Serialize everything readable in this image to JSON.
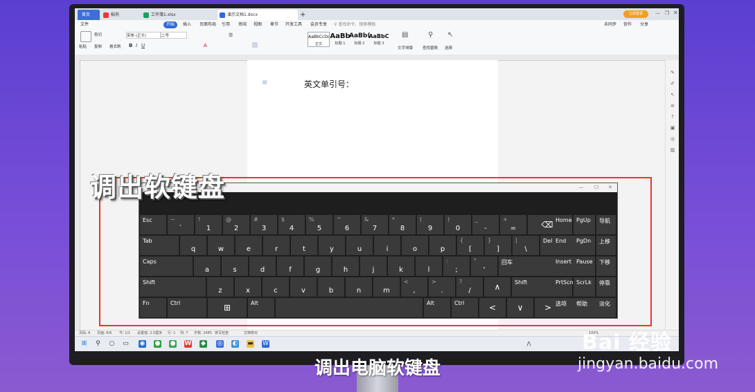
{
  "tabs": [
    {
      "label": "首页"
    },
    {
      "label": "稻壳"
    },
    {
      "label": "工作簿1.xlsx"
    },
    {
      "label": "演示文档1.docx"
    }
  ],
  "tab_add": "+",
  "member_button": "立即登录",
  "menu": [
    "文件",
    "开始",
    "插入",
    "页面布局",
    "引用",
    "审阅",
    "视图",
    "章节",
    "开发工具",
    "会员专享"
  ],
  "search_placeholder": "查找命令、搜索模板",
  "right_actions": [
    "未同步",
    "协作",
    "分享"
  ],
  "ribbon": {
    "paste": "粘贴",
    "cut": "剪切",
    "copy": "复制",
    "format_painter": "格式刷",
    "font_name": "宋体 (正文)",
    "font_size": "二号",
    "styles": [
      {
        "preview": "AaBbCcDd",
        "label": "正文"
      },
      {
        "preview": "AaBb",
        "label": "标题 1"
      },
      {
        "preview": "AaBb(",
        "label": "标题 2"
      },
      {
        "preview": "AaBbC",
        "label": "标题 3"
      }
    ],
    "text_layout": "文字排版",
    "find_replace": "查找替换",
    "select": "选择"
  },
  "document": {
    "text": "英文单引号："
  },
  "status": {
    "page": "页码: 6",
    "pages": "页面: 6/6",
    "section": "节: 1/1",
    "setting": "设置值: 2.5厘米",
    "line": "行: 1",
    "col": "列: 7",
    "words": "字数: 2685",
    "spell": "拼写检查",
    "proof": "文档校对",
    "zoom": "100%"
  },
  "keyboard": {
    "rows": [
      [
        {
          "main": "Esc",
          "left": true
        },
        {
          "top": "~",
          "main": "`"
        },
        {
          "top": "!",
          "main": "1"
        },
        {
          "top": "@",
          "main": "2"
        },
        {
          "top": "#",
          "main": "3"
        },
        {
          "top": "$",
          "main": "4"
        },
        {
          "top": "%",
          "main": "5"
        },
        {
          "top": "^",
          "main": "6"
        },
        {
          "top": "&",
          "main": "7"
        },
        {
          "top": "*",
          "main": "8"
        },
        {
          "top": "(",
          "main": "9"
        },
        {
          "top": ")",
          "main": "0"
        },
        {
          "top": "_",
          "main": "-"
        },
        {
          "top": "+",
          "main": "="
        },
        {
          "glyph": "⌫"
        }
      ],
      [
        {
          "main": "Tab",
          "left": true
        },
        {
          "main": "q"
        },
        {
          "main": "w"
        },
        {
          "main": "e"
        },
        {
          "main": "r"
        },
        {
          "main": "t"
        },
        {
          "main": "y"
        },
        {
          "main": "u"
        },
        {
          "main": "i"
        },
        {
          "main": "o"
        },
        {
          "main": "p"
        },
        {
          "top": "{",
          "main": "["
        },
        {
          "top": "}",
          "main": "]"
        },
        {
          "top": "|",
          "main": "\\"
        },
        {
          "main": "Del",
          "left": true
        }
      ],
      [
        {
          "main": "Caps",
          "left": true
        },
        {
          "main": "a"
        },
        {
          "main": "s"
        },
        {
          "main": "d"
        },
        {
          "main": "f"
        },
        {
          "main": "g"
        },
        {
          "main": "h"
        },
        {
          "main": "j"
        },
        {
          "main": "k"
        },
        {
          "main": "l"
        },
        {
          "top": ":",
          "main": ";"
        },
        {
          "top": "\"",
          "main": "'"
        },
        {
          "main": "回车",
          "left": true
        }
      ],
      [
        {
          "main": "Shift",
          "left": true
        },
        {
          "main": "z"
        },
        {
          "main": "x"
        },
        {
          "main": "c"
        },
        {
          "main": "v"
        },
        {
          "main": "b"
        },
        {
          "main": "n"
        },
        {
          "main": "m"
        },
        {
          "top": "<",
          "main": ","
        },
        {
          "top": ">",
          "main": "."
        },
        {
          "top": "?",
          "main": "/"
        },
        {
          "glyph": "∧"
        },
        {
          "main": "Shift",
          "left": true
        }
      ],
      [
        {
          "main": "Fn",
          "left": true
        },
        {
          "main": "Ctrl",
          "left": true
        },
        {
          "glyph": "⊞"
        },
        {
          "main": "Alt",
          "left": true
        },
        {
          "main": ""
        },
        {
          "main": "Alt",
          "left": true
        },
        {
          "main": "Ctrl",
          "left": true
        },
        {
          "glyph": "<"
        },
        {
          "glyph": "∨"
        },
        {
          "glyph": ">"
        },
        {
          "glyph": "▦"
        }
      ]
    ],
    "nav": [
      [
        {
          "main": "Home"
        },
        {
          "main": "PgUp"
        },
        {
          "main": "导航"
        }
      ],
      [
        {
          "main": "End"
        },
        {
          "main": "PgDn"
        },
        {
          "main": "上移"
        }
      ],
      [
        {
          "main": "Insert"
        },
        {
          "main": "Pause"
        },
        {
          "main": "下移"
        }
      ],
      [
        {
          "main": "PrtScn"
        },
        {
          "main": "ScrLk"
        },
        {
          "main": "停靠"
        }
      ],
      [
        {
          "main": "选项"
        },
        {
          "main": "帮助"
        },
        {
          "main": "淡化"
        }
      ]
    ]
  },
  "overlay": {
    "caption_top": "调出软键盘",
    "caption_bottom": "调出电脑软键盘",
    "watermark_logo": "Bai 经验",
    "watermark_url": "jingyan.baidu.com"
  },
  "colors": {
    "accent": "#2f68d8",
    "highlight_box": "#e8362b",
    "keyboard_bg": "#1e1e1e",
    "key_bg": "#3a3a3a"
  }
}
